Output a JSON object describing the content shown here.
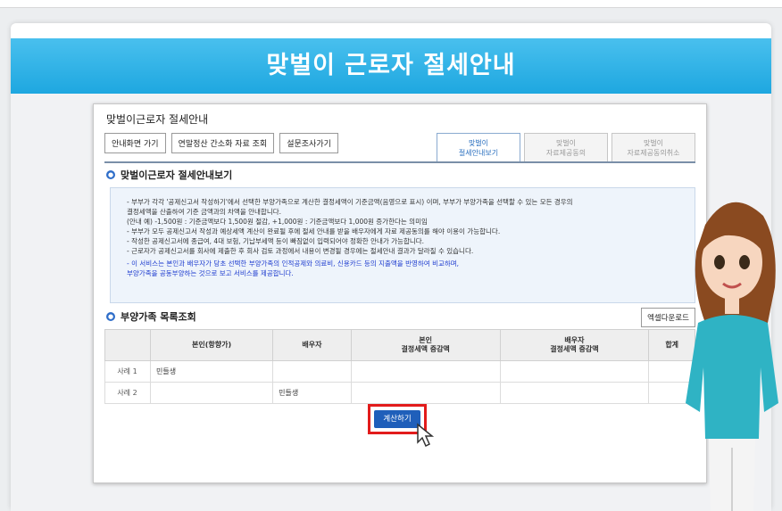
{
  "banner": {
    "title": "맞벌이 근로자 절세안내"
  },
  "panel": {
    "title": "맞벌이근로자 절세안내",
    "buttons": [
      "안내화면 가기",
      "연말정산 간소화 자료 조회",
      "설문조사가기"
    ],
    "tabs": [
      {
        "line1": "맞벌이",
        "line2": "절세안내보기",
        "active": true
      },
      {
        "line1": "맞벌이",
        "line2": "자료제공동의",
        "active": false
      },
      {
        "line1": "맞벌이",
        "line2": "자료제공동의취소",
        "active": false
      }
    ]
  },
  "section1": {
    "title": "맞벌이근로자 절세안내보기"
  },
  "info": {
    "lines": [
      "- 부부가 각각 '공제신고서 작성하기'에서 선택한 부양가족으로 계산한 결정세액이 기준금액(음영으로 표시) 이며, 부부가 부양가족을 선택할 수 있는 모든 경우의",
      "결정세액을 산출하여 기준 금액과의 차액을 안내합니다.",
      "(안내 예) -1,500원 : 기준금액보다 1,500원 절감, +1,000원 : 기준금액보다 1,000원 증가한다는 의미임",
      "- 부부가 모두 공제신고서 작성과 예상세액 계산이 완료될 후에 절세 안내를 받을 배우자에게 자료 제공동의를 해야 이용이 가능합니다.",
      "- 작성한 공제신고서에 종급여, 4대 보험, 기납부세액 등이 빠짐없이 입력되어야 정확한 안내가 가능합니다.",
      "- 근로자가 공제신고서를 회사에 제출한 후 회사 검토 과정에서 내용이 변경될 경우에는 절세안내 결과가 달라질 수 있습니다."
    ],
    "blue_lines": [
      "- 이 서비스는 본인과 배우자가 당초 선택한 부양가족의 인적공제와 의료비, 신용카드 등의 지출액을 반영하여 비교하며,",
      "부양가족을 공동부양하는 것으로 보고 서비스를 제공합니다."
    ]
  },
  "section2": {
    "title": "부양가족 목록조회",
    "excel_button": "엑셀다운로드"
  },
  "table": {
    "headers": [
      "",
      "본인(항향가)",
      "배우자",
      "본인\n결정세액 증감액",
      "배우자\n결정세액 증감액",
      "합계"
    ],
    "rows": [
      [
        "사례 1",
        "민들생",
        "",
        "",
        "",
        ""
      ],
      [
        "사례 2",
        "",
        "민들생",
        "",
        "",
        ""
      ]
    ]
  },
  "calc_button": "계산하기",
  "colors": {
    "banner": "#1ea7e0",
    "highlight": "#e21b1b",
    "button": "#1f5fba"
  }
}
